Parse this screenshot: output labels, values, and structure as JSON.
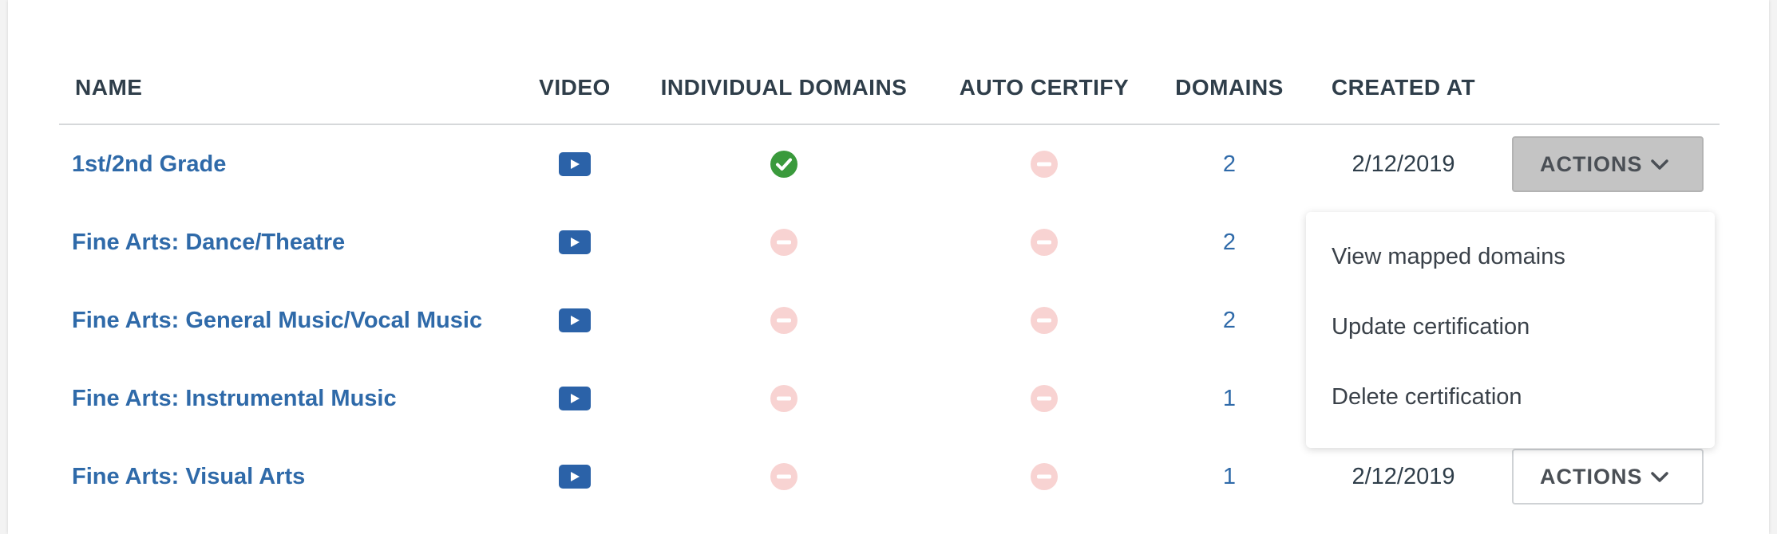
{
  "table": {
    "headers": {
      "name": "NAME",
      "video": "VIDEO",
      "individual_domains": "INDIVIDUAL DOMAINS",
      "auto_certify": "AUTO CERTIFY",
      "domains": "DOMAINS",
      "created_at": "CREATED AT"
    },
    "rows": [
      {
        "name": "1st/2nd Grade",
        "individual_domains": "check",
        "auto_certify": "none",
        "domains": "2",
        "created_at": "2/12/2019",
        "actions": "ACTIONS"
      },
      {
        "name": "Fine Arts: Dance/Theatre",
        "individual_domains": "none",
        "auto_certify": "none",
        "domains": "2"
      },
      {
        "name": "Fine Arts: General Music/Vocal Music",
        "individual_domains": "none",
        "auto_certify": "none",
        "domains": "2"
      },
      {
        "name": "Fine Arts: Instrumental Music",
        "individual_domains": "none",
        "auto_certify": "none",
        "domains": "1"
      },
      {
        "name": "Fine Arts: Visual Arts",
        "individual_domains": "none",
        "auto_certify": "none",
        "domains": "1",
        "created_at": "2/12/2019",
        "actions": "ACTIONS"
      }
    ]
  },
  "actions_menu": {
    "items": [
      "View mapped domains",
      "Update certification",
      "Delete certification"
    ]
  },
  "colors": {
    "link": "#2f6aa9",
    "video_icon_bg": "#2b62a8",
    "check_green": "#3a9a3c",
    "disabled_icon": "#f8d3d2",
    "header_text": "#2f3e4a",
    "active_button_bg": "#c4c4c4"
  },
  "icons": {
    "video": "play-video-icon",
    "check": "check-circle-icon",
    "none": "minus-circle-icon",
    "dropdown": "chevron-down-icon"
  }
}
